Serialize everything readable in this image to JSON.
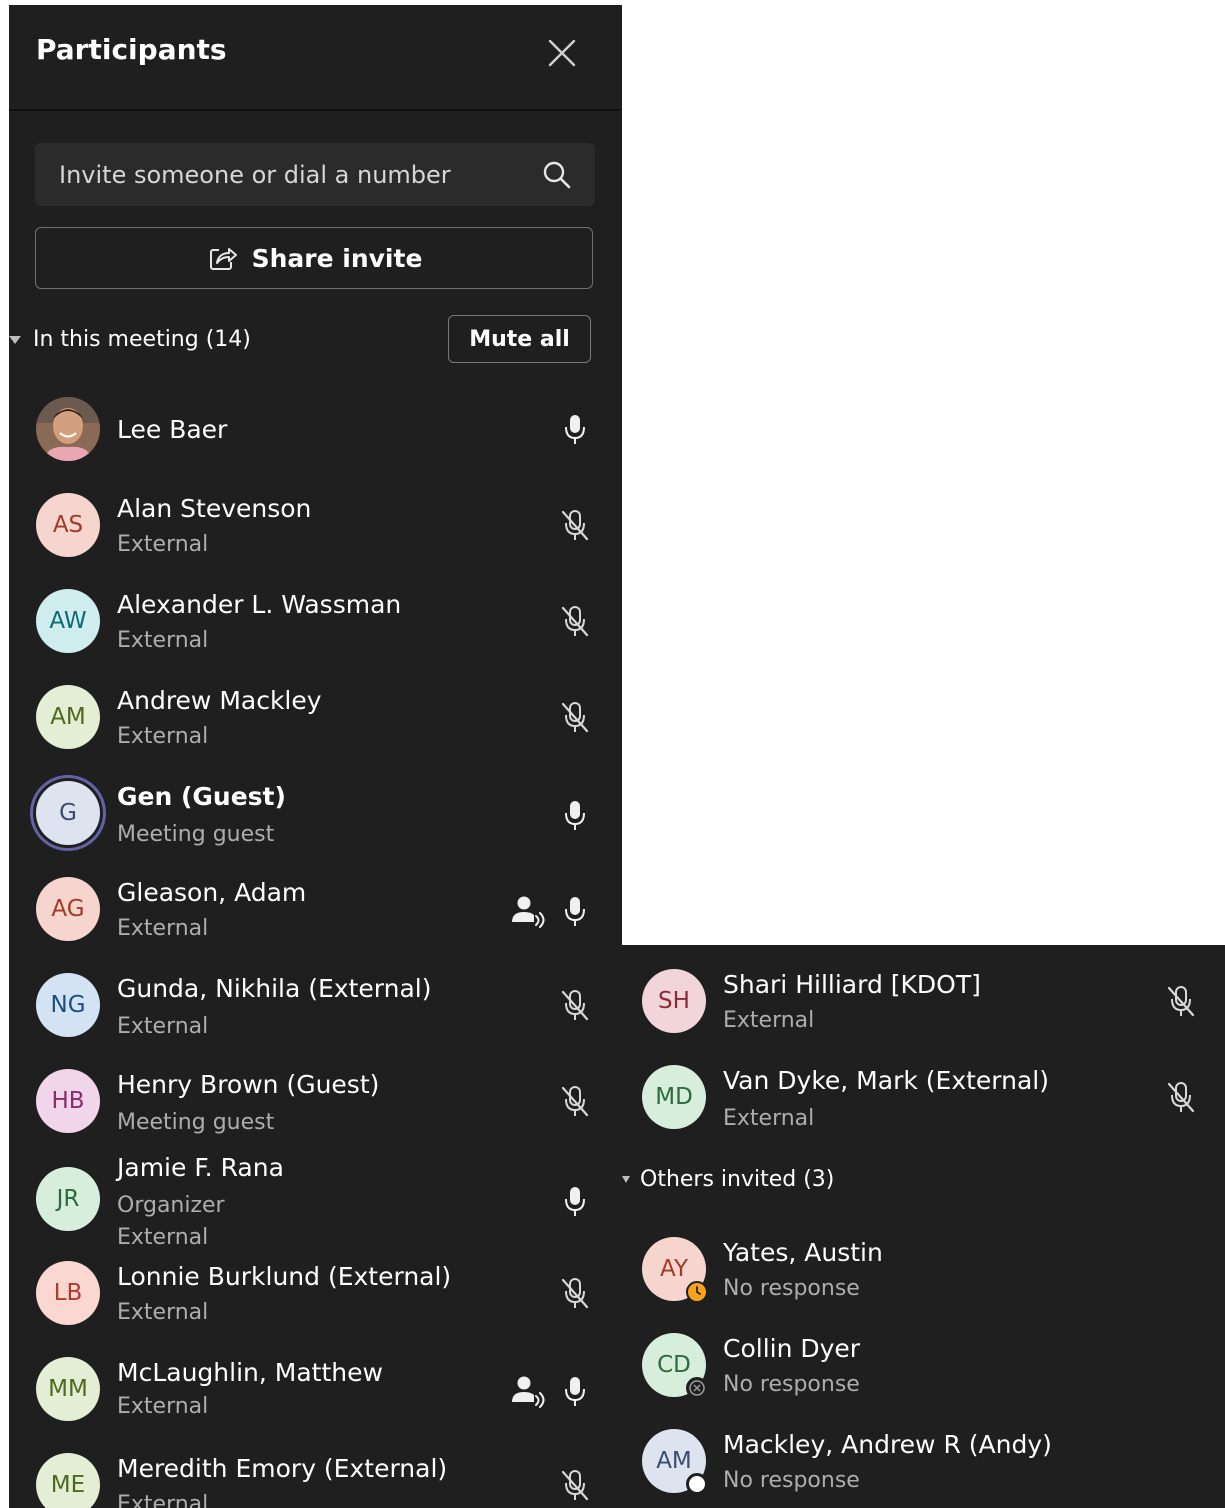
{
  "header": {
    "title": "Participants"
  },
  "search": {
    "placeholder": "Invite someone or dial a number"
  },
  "share": {
    "label": "Share invite"
  },
  "meeting": {
    "label": "In this meeting (14)",
    "mute_all": "Mute all",
    "participants": [
      {
        "name": "Lee Baer",
        "sub": "",
        "mic": "on"
      },
      {
        "name": "Alan Stevenson",
        "initials": "AS",
        "sub": "External",
        "mic": "muted"
      },
      {
        "name": "Alexander L. Wassman",
        "initials": "AW",
        "sub": "External",
        "mic": "muted"
      },
      {
        "name": "Andrew Mackley",
        "initials": "AM",
        "sub": "External",
        "mic": "muted"
      },
      {
        "name": "Gen (Guest)",
        "initials": "G",
        "sub": "Meeting guest",
        "mic": "on"
      },
      {
        "name": "Gleason, Adam",
        "initials": "AG",
        "sub": "External",
        "mic": "on"
      },
      {
        "name": "Gunda, Nikhila (External)",
        "initials": "NG",
        "sub": "External",
        "mic": "muted"
      },
      {
        "name": "Henry Brown (Guest)",
        "initials": "HB",
        "sub": "Meeting guest",
        "mic": "muted"
      },
      {
        "name": "Jamie F. Rana",
        "initials": "JR",
        "sub": "Organizer",
        "sub2": "External",
        "mic": "on"
      },
      {
        "name": "Lonnie Burklund (External)",
        "initials": "LB",
        "sub": "External",
        "mic": "muted"
      },
      {
        "name": "McLaughlin, Matthew",
        "initials": "MM",
        "sub": "External",
        "mic": "on"
      },
      {
        "name": "Meredith Emory (External)",
        "initials": "ME",
        "sub": "External",
        "mic": "muted"
      },
      {
        "name": "Shari Hilliard [KDOT]",
        "initials": "SH",
        "sub": "External",
        "mic": "muted"
      },
      {
        "name": "Van Dyke, Mark (External)",
        "initials": "MD",
        "sub": "External",
        "mic": "muted"
      }
    ]
  },
  "invited": {
    "label": "Others invited (3)",
    "people": [
      {
        "name": "Yates, Austin",
        "initials": "AY",
        "sub": "No response"
      },
      {
        "name": "Collin Dyer",
        "initials": "CD",
        "sub": "No response"
      },
      {
        "name": "Mackley, Andrew R (Andy)",
        "initials": "AM",
        "sub": "No response"
      }
    ]
  },
  "colors": {
    "panel": "#1f1f1f",
    "search_bg": "#2b2b2b",
    "secondary_text": "#adadad",
    "guest_ring": "#6264a7",
    "away_badge": "#f8a31b"
  }
}
